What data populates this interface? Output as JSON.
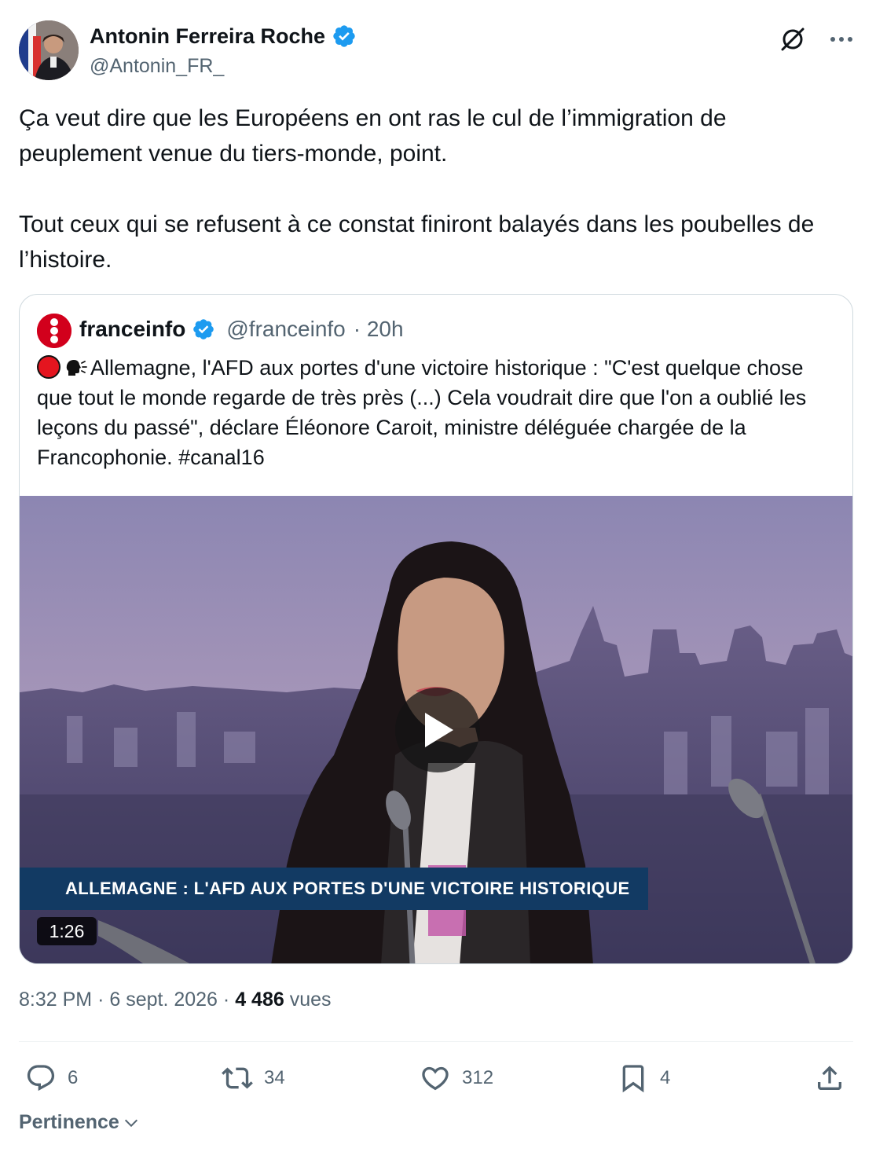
{
  "author": {
    "name": "Antonin Ferreira Roche",
    "handle": "@Antonin_FR_",
    "verified": true
  },
  "tweet": {
    "paragraphs": [
      "Ça veut dire que les Européens en ont ras le cul de l’immigration de peuplement venue du tiers-monde, point.",
      "Tout ceux qui se refusent à ce constat finiront balayés dans les poubelles de l’histoire."
    ]
  },
  "quote": {
    "name": "franceinfo",
    "handle": "@franceinfo",
    "time": "· 20h",
    "text": "Allemagne, l'AFD aux portes d'une victoire historique : \"C'est quelque chose que tout le monde regarde de très près (...) Cela voudrait dire que l'on a oublié les leçons du passé\", déclare Éléonore Caroit, ministre déléguée chargée de la Francophonie. #canal16",
    "video": {
      "chyron": "ALLEMAGNE : L'AFD AUX PORTES D'UNE VICTOIRE HISTORIQUE",
      "duration": "1:26"
    }
  },
  "meta": {
    "time": "8:32 PM",
    "date": "6 sept. 2026",
    "views_count": "4 486",
    "views_label": "vues"
  },
  "actions": {
    "replies": "6",
    "reposts": "34",
    "likes": "312",
    "bookmarks": "4"
  },
  "sort": {
    "label": "Pertinence"
  },
  "colors": {
    "verified_blue": "#1d9bf0",
    "secondary_text": "#536471",
    "chyron_bg": "#123a63",
    "franceinfo_red": "#d2001c"
  },
  "icons": [
    "grok-icon",
    "more-icon",
    "verified-badge-icon",
    "live-dot-icon",
    "speaking-head-icon",
    "play-icon",
    "reply-icon",
    "repost-icon",
    "like-icon",
    "bookmark-icon",
    "share-icon",
    "chevron-down-icon"
  ]
}
